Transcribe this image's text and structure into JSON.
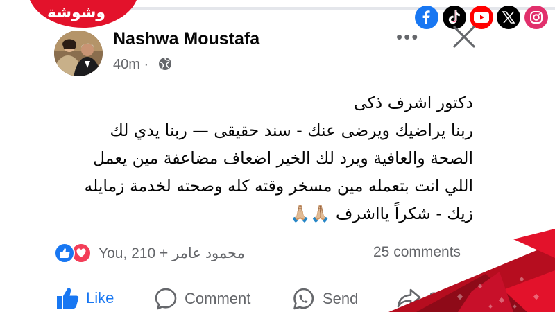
{
  "brand": {
    "logo_text": "وشوشة",
    "color": "#e3122b"
  },
  "social_links": [
    {
      "name": "facebook",
      "color": "#1877f2"
    },
    {
      "name": "tiktok",
      "color": "#000000"
    },
    {
      "name": "youtube",
      "color": "#ff0000"
    },
    {
      "name": "x",
      "color": "#000000"
    },
    {
      "name": "instagram",
      "color": "#e1306c"
    }
  ],
  "post": {
    "author": "Nashwa Moustafa",
    "time": "40m",
    "separator": "·",
    "privacy_icon": "globe-icon",
    "more_label": "•••",
    "lines": [
      "دكتور اشرف ذكى",
      "ربنا يراضيك ويرضى عنك -  سند حقيقى —  ربنا يدي لك",
      "الصحة والعافية ويرد لك الخير اضعاف مضاعفة مين يعمل",
      "اللي انت بتعمله مين مسخر وقته كله وصحته لخدمة زمايله",
      "زيك - شكراً يااشرف 🙏🏼🙏🏼"
    ]
  },
  "stats": {
    "reactions_text": "You, محمود عامر + 210",
    "comments": "25 comments"
  },
  "actions": {
    "like": "Like",
    "comment": "Comment",
    "send": "Send",
    "share": "Sh"
  },
  "colors": {
    "accent": "#1877f2",
    "muted": "#65676b",
    "love": "#f33e58"
  }
}
